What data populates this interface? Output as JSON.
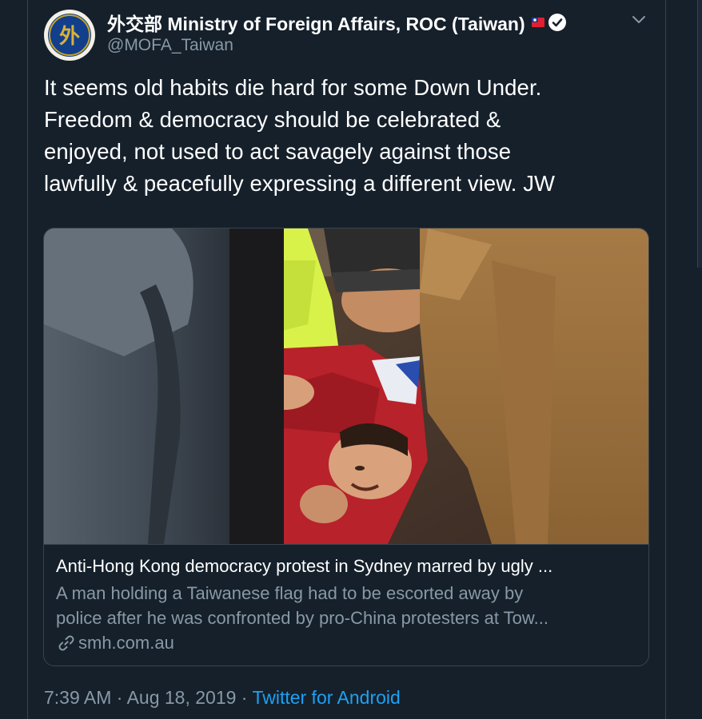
{
  "account": {
    "display_name": "外交部 Ministry of Foreign Affairs, ROC (Taiwan)",
    "handle": "@MOFA_Taiwan",
    "avatar_glyph": "外",
    "flag_icon": "taiwan-flag-icon",
    "verified_icon": "verified-badge-icon"
  },
  "tweet": {
    "lines": [
      "It seems old habits die hard for some Down Under.",
      "Freedom & democracy should be celebrated &",
      "enjoyed, not used to act savagely against those",
      "lawfully & peacefully expressing a different view. JW"
    ]
  },
  "card": {
    "title": "Anti-Hong Kong democracy protest in Sydney marred by ugly ...",
    "description_lines": [
      "A man holding a Taiwanese flag had to be escorted away by",
      "police after he was confronted by pro-China protesters at Tow..."
    ],
    "domain": "smh.com.au",
    "link_icon": "link-icon",
    "photo_label": "protest scuffle photo"
  },
  "meta": {
    "time": "7:39 AM",
    "separator": " · ",
    "date": "Aug 18, 2019",
    "source": "Twitter for Android"
  },
  "colors": {
    "background": "#15202b",
    "border": "#38444d",
    "secondary_text": "#8899a6",
    "link_blue": "#1da1f2"
  }
}
